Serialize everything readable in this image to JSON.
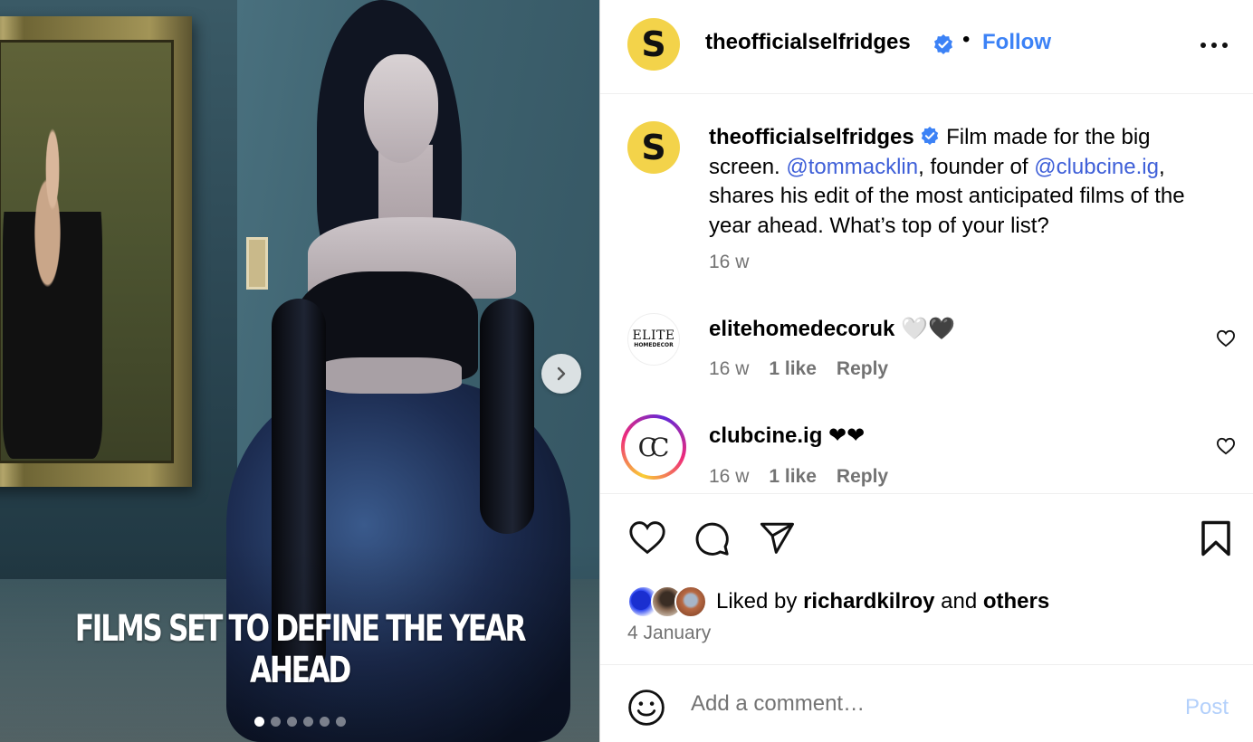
{
  "media": {
    "overlay_title": "FILMS SET TO DEFINE THE YEAR AHEAD",
    "carousel_dots": 6,
    "active_dot": 0
  },
  "header": {
    "avatar_letter": "S",
    "username": "theofficialselfridges",
    "separator": "•",
    "follow_label": "Follow"
  },
  "caption": {
    "avatar_letter": "S",
    "username": "theofficialselfridges",
    "text_1": " Film made for the big screen. ",
    "mention_1": "@tommacklin",
    "text_2": ", founder of ",
    "mention_2": "@clubcine.ig",
    "text_3": ", shares his edit of the most anticipated films of the year ahead. What’s top of your list?",
    "time": "16 w"
  },
  "comments": [
    {
      "avatar_top": "ELITE",
      "avatar_bottom": "HOMEDECOR",
      "username": "elitehomedecoruk",
      "text": " 🤍🖤",
      "time": "16 w",
      "likes": "1 like",
      "reply": "Reply"
    },
    {
      "avatar_text": "CC",
      "username": "clubcine.ig",
      "text": " ❤❤",
      "time": "16 w",
      "likes": "1 like",
      "reply": "Reply"
    }
  ],
  "likes": {
    "prefix": "Liked by ",
    "user": "richardkilroy",
    "middle": " and ",
    "others": "others"
  },
  "post_date": "4 January",
  "add_comment": {
    "placeholder": "Add a comment…",
    "post_label": "Post"
  },
  "colors": {
    "accent": "#3c82f6",
    "mention": "#3e5fd8",
    "muted": "#737373",
    "post_disabled": "#b3d0fb",
    "avatar_yellow": "#f3d34a"
  }
}
